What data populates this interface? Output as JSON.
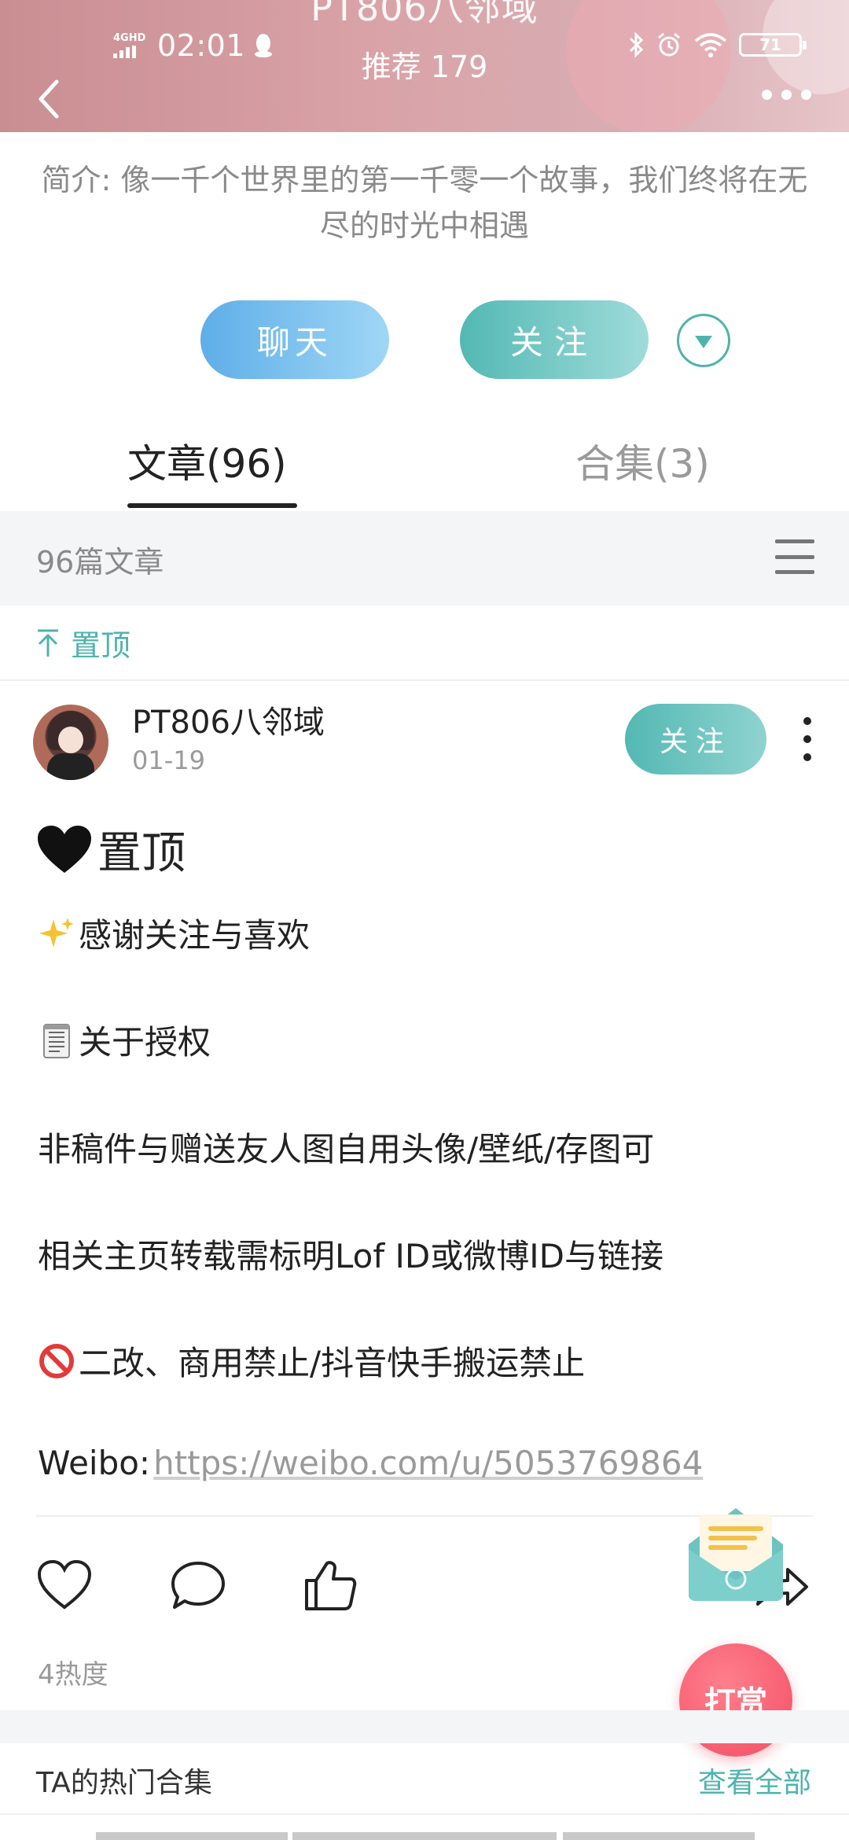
{
  "status_bar": {
    "network": "4GHD",
    "time": "02:01",
    "battery": "71"
  },
  "header": {
    "title": "PT806八邻域",
    "recommend": "推荐 179"
  },
  "profile": {
    "intro": "简介: 像一千个世界里的第一千零一个故事，我们终将在无尽的时光中相遇",
    "chat_label": "聊天",
    "follow_label": "关注"
  },
  "tabs": [
    {
      "label": "文章(96)",
      "active": true
    },
    {
      "label": "合集(3)",
      "active": false
    }
  ],
  "filter": {
    "count": "96篇文章"
  },
  "pinned_label": "置顶",
  "post": {
    "author": "PT806八邻域",
    "date": "01-19",
    "follow_label": "关注",
    "title": "置顶",
    "lines": [
      "感谢关注与喜欢",
      "关于授权",
      "非稿件与赠送友人图自用头像/壁纸/存图可",
      "相关主页转载需标明Lof ID或微博ID与链接",
      "二改、商用禁止/抖音快手搬运禁止"
    ],
    "weibo_prefix": "Weibo:",
    "weibo_url": "https://weibo.com/u/5053769864",
    "heat": "4热度"
  },
  "reward_label": "打赏",
  "hot_collections": {
    "title": "TA的热门合集",
    "view_all": "查看全部"
  },
  "colors": {
    "accent_teal": "#4fb3ad",
    "chat_blue": "#5eaee8",
    "reward_red": "#f24f64"
  }
}
